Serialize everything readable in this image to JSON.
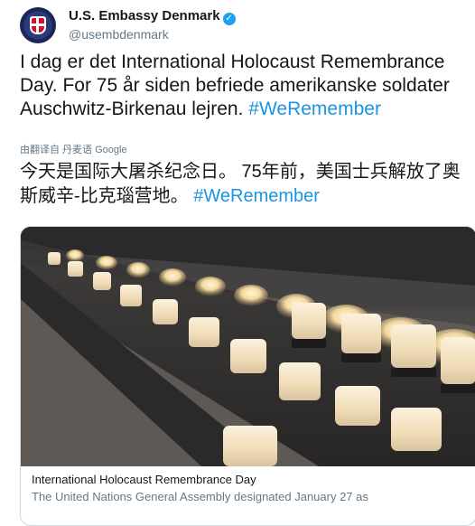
{
  "account": {
    "display_name": "U.S. Embassy Denmark",
    "handle": "@usembdenmark",
    "verified_icon": "verified-check-icon"
  },
  "tweet": {
    "text_danish": "I dag er det International Holocaust Remembrance Day. For 75 år siden befriede amerikanske soldater Auschwitz-Birkenau lejren.",
    "hashtag_1": "#WeRemember",
    "translated_by_label": "由翻译自 丹麦语",
    "translator": "Google",
    "text_chinese": "今天是国际大屠杀纪念日。 75年前，美国士兵解放了奥斯威辛-比克瑙营地。",
    "hashtag_2": "#WeRemember"
  },
  "card": {
    "image_alt": "memorial candles",
    "title": "International Holocaust Remembrance Day",
    "description": "The United Nations General Assembly designated January 27 as"
  },
  "colors": {
    "hashtag": "#1b95e0",
    "verified": "#1da1f2",
    "secondary_text": "#657786"
  }
}
